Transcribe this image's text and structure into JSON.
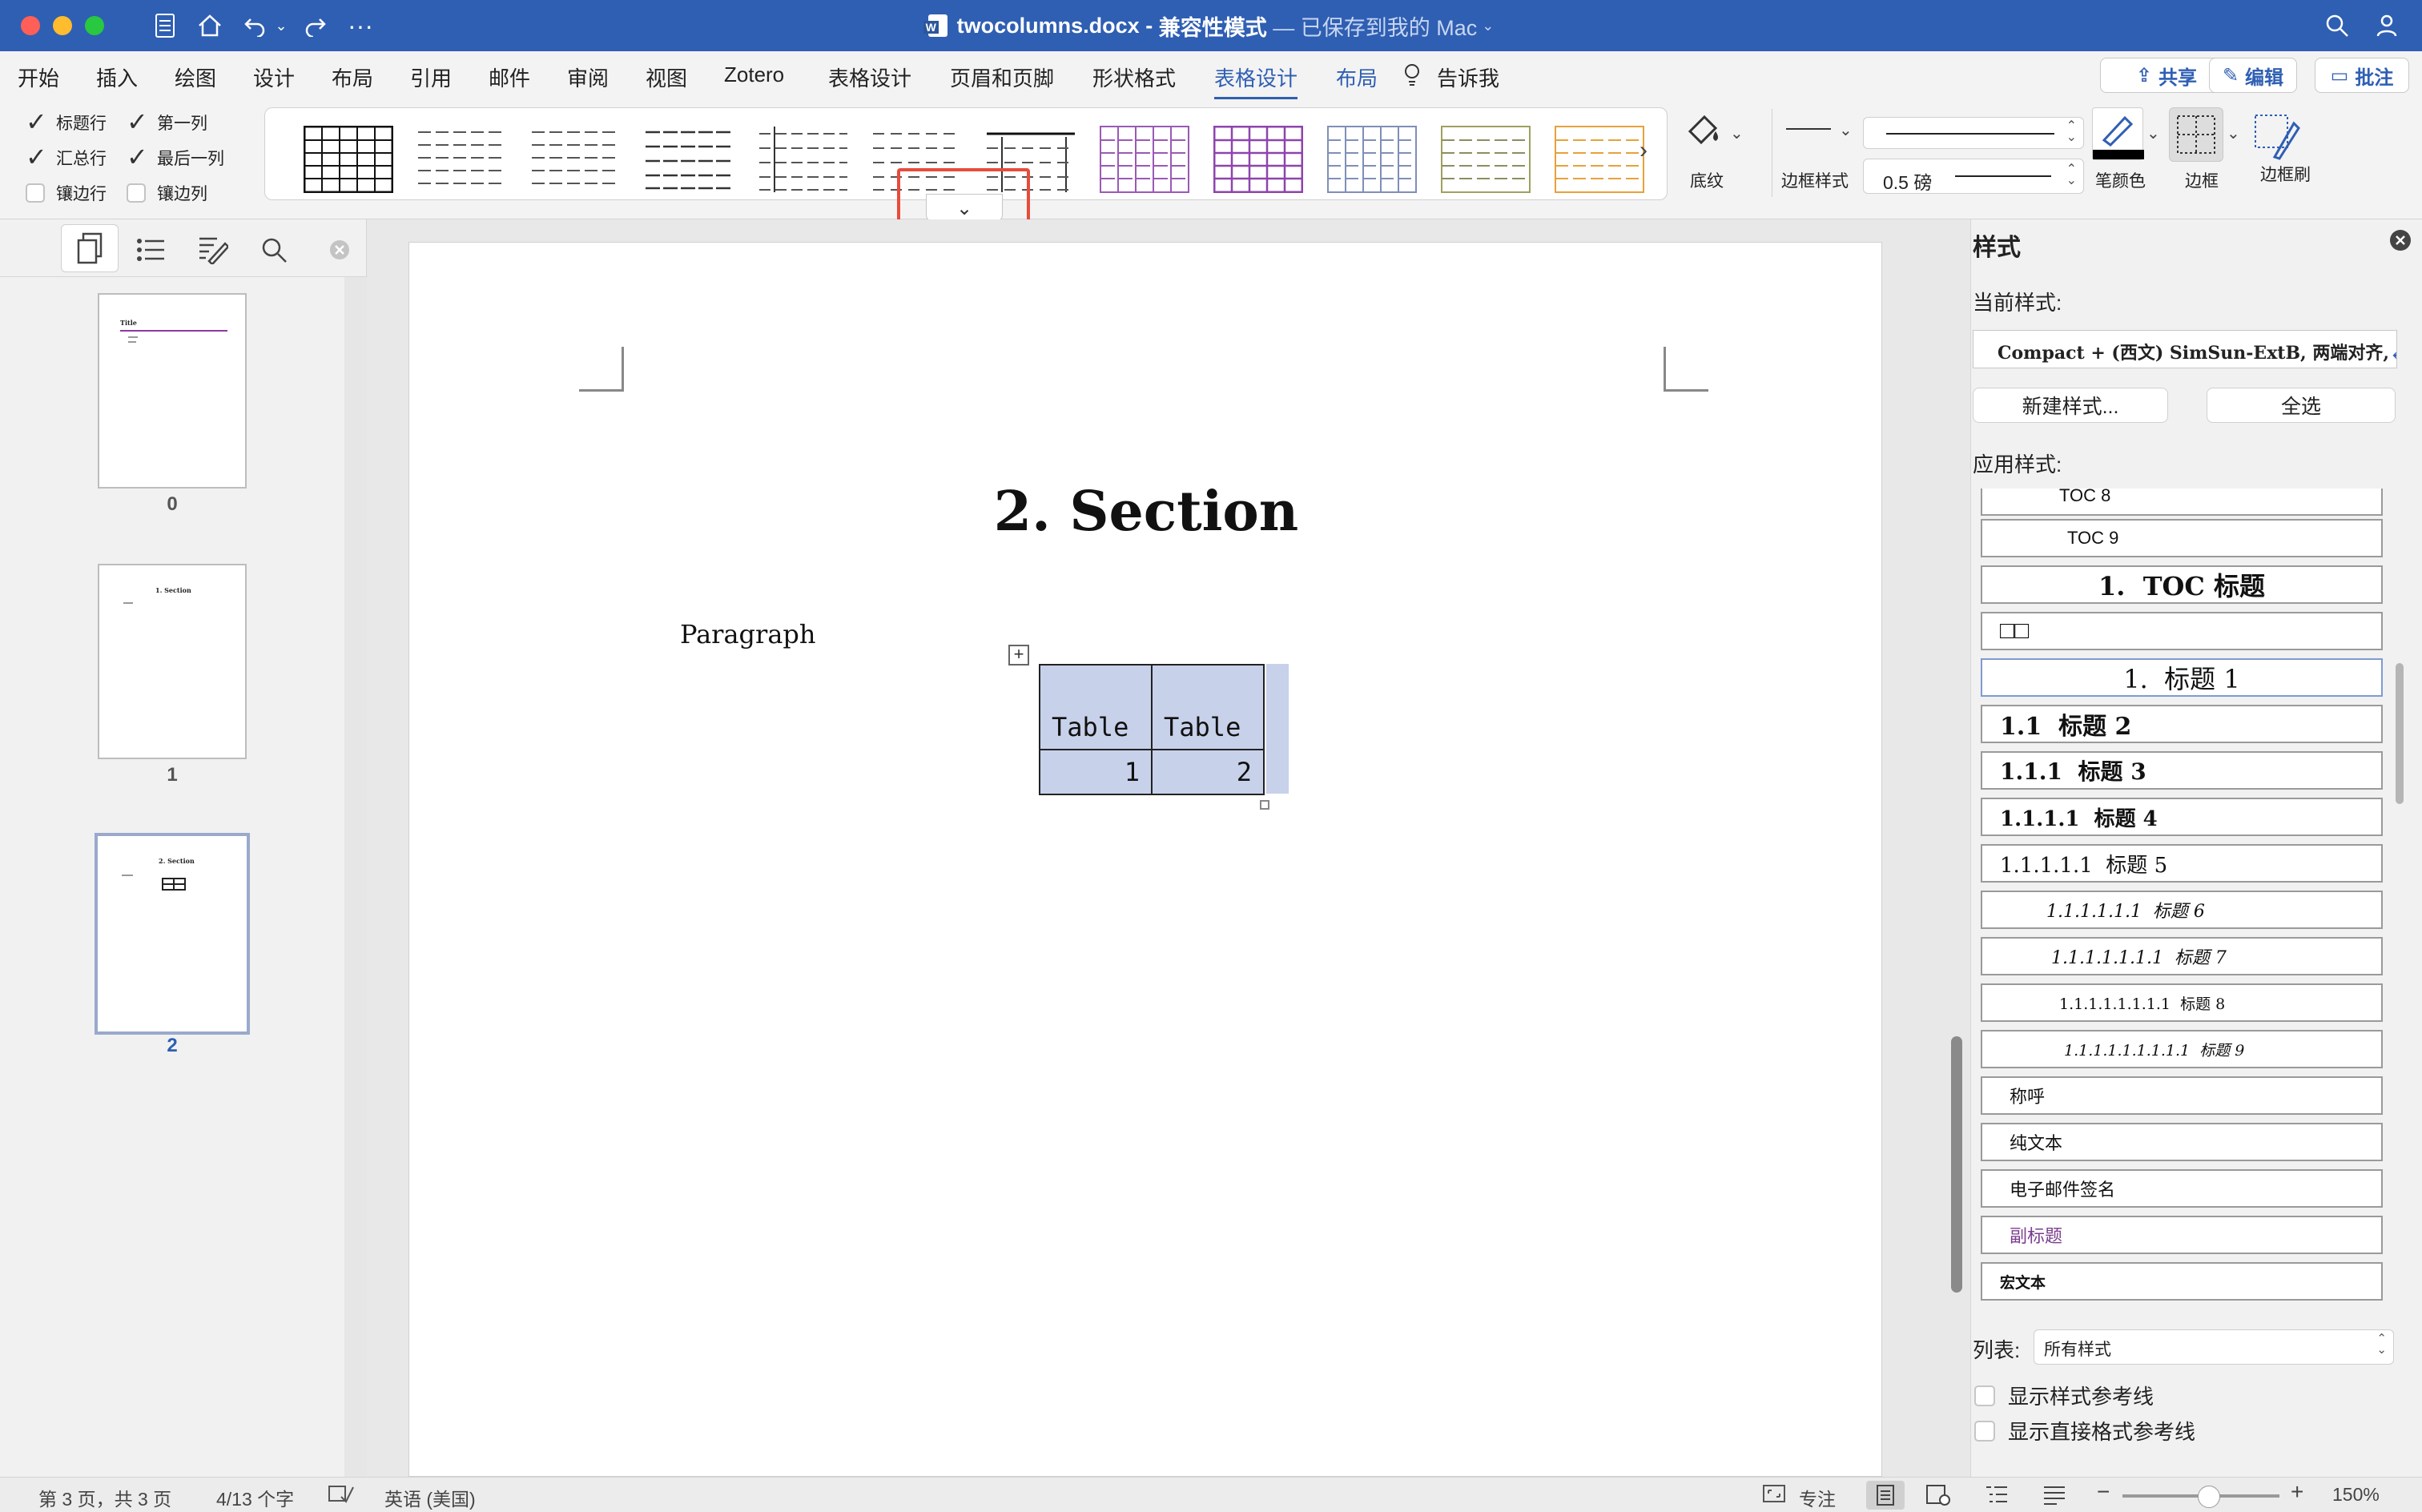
{
  "title_bar": {
    "undo_icon": "undo-icon",
    "redo_icon": "redo-icon",
    "filename": "twocolumns.docx",
    "separator": " - ",
    "mode": "兼容性模式",
    "status": " — 已保存到我的 Mac",
    "search_icon": "search-icon",
    "share_person_icon": "person-icon"
  },
  "menu": {
    "items": [
      "开始",
      "插入",
      "绘图",
      "设计",
      "布局",
      "引用",
      "邮件",
      "审阅",
      "视图",
      "Zotero",
      "表格设计",
      "页眉和页脚",
      "形状格式",
      "表格设计",
      "布局"
    ],
    "tell_me": "告诉我",
    "share": "共享",
    "edit": "编辑",
    "comment": "批注"
  },
  "ribbon": {
    "options": [
      {
        "label": "标题行",
        "checked": true
      },
      {
        "label": "汇总行",
        "checked": true
      },
      {
        "label": "镶边行",
        "checked": false
      },
      {
        "label": "第一列",
        "checked": true
      },
      {
        "label": "最后一列",
        "checked": true
      },
      {
        "label": "镶边列",
        "checked": false
      }
    ],
    "shading": "底纹",
    "border_styles": "边框样式",
    "line_weight": "0.5 磅",
    "pen_color": "笔颜色",
    "borders": "边框",
    "border_painter": "边框刷",
    "gallery_accent_colors": [
      "#9b59b6",
      "#8e44ad",
      "#7f8fb8",
      "#a0a060",
      "#e6a23c"
    ]
  },
  "left_pane": {
    "pages": [
      {
        "number": "0",
        "title": "Title"
      },
      {
        "number": "1",
        "title": "1. Section"
      },
      {
        "number": "2",
        "title": "2. Section"
      }
    ]
  },
  "document": {
    "heading": "2. Section",
    "paragraph": "Paragraph",
    "table": [
      [
        "Table",
        "Table"
      ],
      [
        "1",
        "2"
      ]
    ]
  },
  "styles_pane": {
    "title": "样式",
    "current_label": "当前样式:",
    "current_value": "Compact + (西文) SimSun-ExtB, 两端对齐,",
    "new_style": "新建样式...",
    "select_all": "全选",
    "apply_label": "应用样式:",
    "styles": [
      "TOC 8",
      "TOC 9",
      "1.  TOC 标题",
      "□□",
      "1.  标题 1",
      "1.1  标题 2",
      "1.1.1  标题 3",
      "1.1.1.1  标题 4",
      "1.1.1.1.1  标题 5",
      "1.1.1.1.1.1  标题 6",
      "1.1.1.1.1.1.1  标题 7",
      "1.1.1.1.1.1.1.1  标题 8",
      "1.1.1.1.1.1.1.1.1  标题 9",
      "称呼",
      "纯文本",
      "电子邮件签名",
      "副标题",
      "宏文本"
    ],
    "list_label": "列表:",
    "list_value": "所有样式",
    "show_guides": "显示样式参考线",
    "show_direct": "显示直接格式参考线"
  },
  "status_bar": {
    "page": "第 3 页，共 3 页",
    "words": "4/13 个字",
    "language": "英语 (美国)",
    "focus": "专注",
    "zoom": "150%"
  }
}
